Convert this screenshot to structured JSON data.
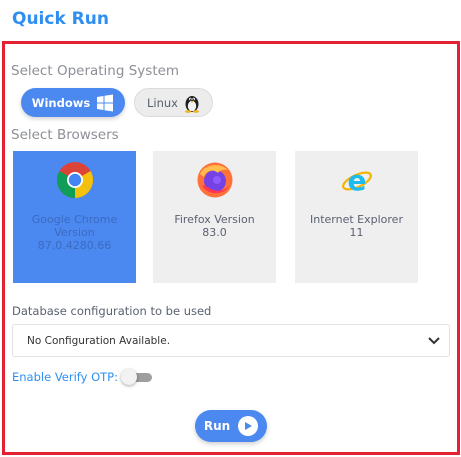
{
  "header": {
    "title": "Quick Run"
  },
  "os_section": {
    "label": "Select Operating System",
    "options": [
      {
        "label": "Windows",
        "selected": true,
        "icon": "windows-icon"
      },
      {
        "label": "Linux",
        "selected": false,
        "icon": "linux-tux-icon"
      }
    ]
  },
  "browser_section": {
    "label": "Select Browsers",
    "browsers": [
      {
        "name": "Google Chrome Version",
        "version": "87.0.4280.66",
        "selected": true,
        "icon": "chrome-icon"
      },
      {
        "name": "Firefox Version",
        "version": "83.0",
        "selected": false,
        "icon": "firefox-icon"
      },
      {
        "name": "Internet Explorer",
        "version": "11",
        "selected": false,
        "icon": "internet-explorer-icon"
      }
    ]
  },
  "database": {
    "label": "Database configuration to be used",
    "selected_value": "No Configuration Available."
  },
  "otp": {
    "label": "Enable Verify OTP:",
    "enabled": false
  },
  "actions": {
    "run_label": "Run"
  },
  "colors": {
    "accent": "#4b88f0",
    "title": "#2e8ff0",
    "frame_border": "#e32132",
    "card_inactive": "#efefef"
  }
}
